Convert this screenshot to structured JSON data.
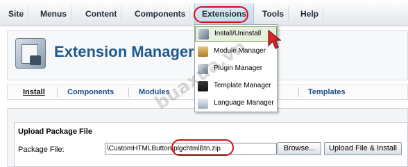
{
  "menu": {
    "items": [
      "Site",
      "Menus",
      "Content",
      "Components",
      "Extensions",
      "Tools",
      "Help"
    ],
    "active": "Extensions"
  },
  "dropdown": {
    "items": [
      {
        "label": "Install/Uninstall",
        "icon": "install-icon"
      },
      {
        "label": "Module Manager",
        "icon": "module-icon"
      },
      {
        "label": "Plugin Manager",
        "icon": "plugin-icon"
      },
      {
        "label": "Template Manager",
        "icon": "template-icon"
      },
      {
        "label": "Language Manager",
        "icon": "language-icon"
      }
    ],
    "hovered": "Install/Uninstall"
  },
  "header": {
    "title": "Extension Manager"
  },
  "tabs": [
    "Install",
    "Components",
    "Modules",
    "Templates"
  ],
  "upload": {
    "section_title": "Upload Package File",
    "field_label": "Package File:",
    "file_value": "\\CustomHTMLButton\\plgchtmlBtn.zip",
    "browse_label": "Browse...",
    "submit_label": "Upload File & Install"
  },
  "watermark": "buaxua.vn",
  "colors": {
    "highlight_red": "#d20f12",
    "title_blue": "#1f5a8e",
    "link_blue": "#1d4f86"
  }
}
